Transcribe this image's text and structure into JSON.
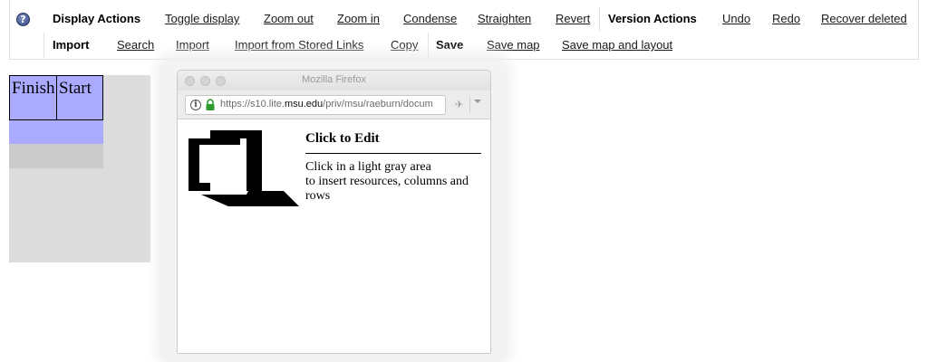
{
  "toolbar": {
    "row1": {
      "display_actions": "Display Actions",
      "toggle_display": "Toggle display",
      "zoom_out": "Zoom out",
      "zoom_in": "Zoom in",
      "condense": "Condense",
      "straighten": "Straighten",
      "revert": "Revert",
      "version_actions": "Version Actions",
      "undo": "Undo",
      "redo": "Redo",
      "recover_deleted": "Recover deleted"
    },
    "row2": {
      "import_heading": "Import",
      "search": "Search",
      "import": "Import",
      "import_stored_links": "Import from Stored Links",
      "copy": "Copy",
      "save_heading": "Save",
      "save_map": "Save map",
      "save_map_layout": "Save map and layout"
    },
    "help_icon_glyph": "?"
  },
  "grid": {
    "cells": [
      "Finish",
      "Start"
    ],
    "cell_color": "#aaaaff",
    "background_color": "#dcdcdc"
  },
  "browser": {
    "title": "Mozilla Firefox",
    "url_prefix": "https://s10.lite.",
    "url_domain": "msu.edu",
    "url_suffix": "/priv/msu/raeburn/docum",
    "info_glyph": "i",
    "extension_glyph": "✈",
    "content": {
      "edit_title": "Click to Edit",
      "edit_line1": "Click in a light gray area",
      "edit_line2": "to insert resources, columns and rows"
    }
  }
}
